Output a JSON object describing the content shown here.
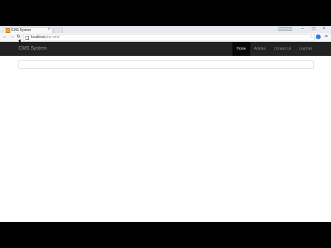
{
  "browser": {
    "tab": {
      "title": "CMS System",
      "close_glyph": "×",
      "favicon": "page-favicon-icon"
    },
    "user_badge": "Narasimhan",
    "window_controls": {
      "minimize": "–",
      "maximize": "▢",
      "close": "×"
    },
    "nav": {
      "back": "←",
      "forward": "→",
      "reload": "↻"
    },
    "address": {
      "host": "localhost",
      "path": "/php-cms/",
      "star": "☆"
    },
    "menu_glyph": "≡"
  },
  "site": {
    "brand": "CMS System",
    "nav_items": [
      {
        "label": "Home",
        "active": true
      },
      {
        "label": "Articles",
        "active": false
      },
      {
        "label": "Contact Us",
        "active": false
      },
      {
        "label": "Log Out",
        "active": false
      }
    ]
  }
}
